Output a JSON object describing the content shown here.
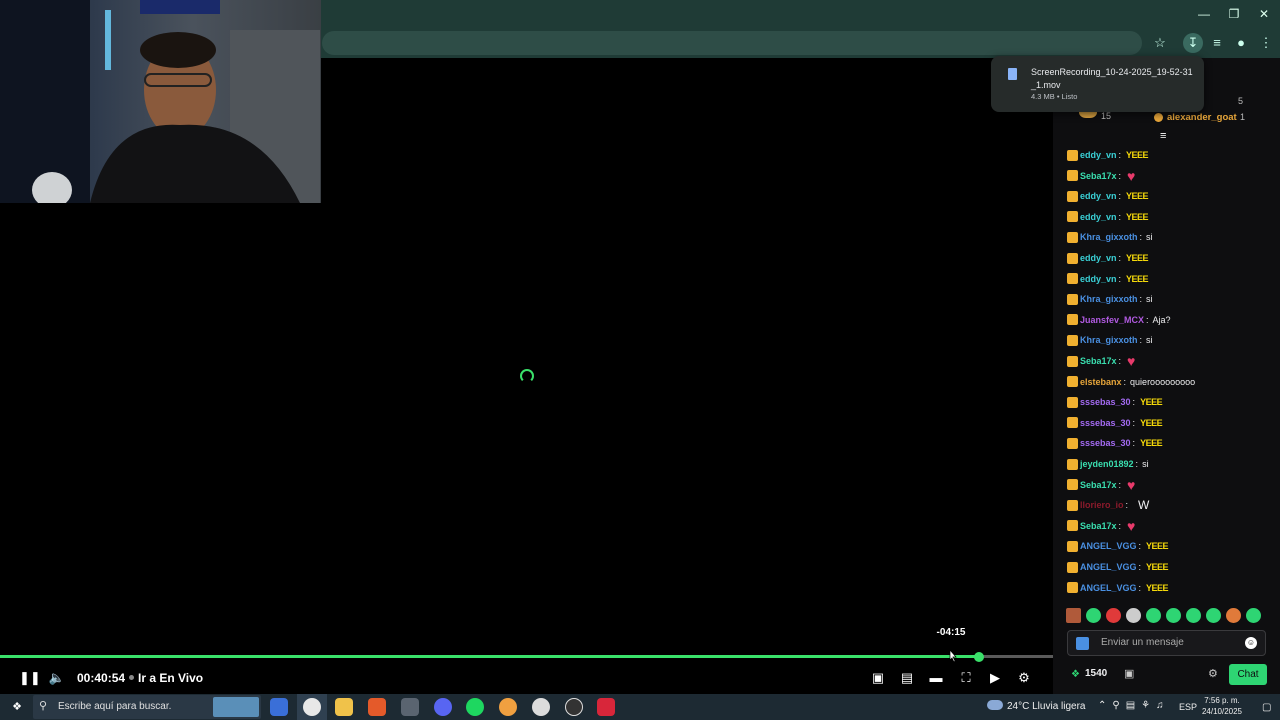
{
  "download": {
    "filename": "ScreenRecording_10-24-2025_19-52-31_1.mov",
    "status": "4.3 MB • Listo"
  },
  "player": {
    "seek_tooltip": "-04:15",
    "current_time": "00:40:54",
    "go_live_label": "Ir a En Vivo",
    "progress_fraction": 0.93
  },
  "chat_top": {
    "count_right": "5",
    "count_left": "15",
    "top_user": "alexander_goat",
    "top_user_count": "1"
  },
  "chat_messages": [
    {
      "user": "eddy_vn",
      "color": "#3ad0d6",
      "text": "",
      "emote": "YEEE"
    },
    {
      "user": "Seba17x",
      "color": "#3adfb0",
      "text": "",
      "emote": "heart"
    },
    {
      "user": "eddy_vn",
      "color": "#3ad0d6",
      "text": "",
      "emote": "YEEE"
    },
    {
      "user": "eddy_vn",
      "color": "#3ad0d6",
      "text": "",
      "emote": "YEEE"
    },
    {
      "user": "Khra_gixxoth",
      "color": "#4a90e2",
      "text": "si",
      "emote": ""
    },
    {
      "user": "eddy_vn",
      "color": "#3ad0d6",
      "text": "",
      "emote": "YEEE"
    },
    {
      "user": "eddy_vn",
      "color": "#3ad0d6",
      "text": "",
      "emote": "YEEE"
    },
    {
      "user": "Khra_gixxoth",
      "color": "#4a90e2",
      "text": "si",
      "emote": ""
    },
    {
      "user": "Juansfev_MCX",
      "color": "#b05ae0",
      "text": "Aja?",
      "emote": ""
    },
    {
      "user": "Khra_gixxoth",
      "color": "#4a90e2",
      "text": "si",
      "emote": ""
    },
    {
      "user": "Seba17x",
      "color": "#3adfb0",
      "text": "",
      "emote": "heart"
    },
    {
      "user": "elstebanx",
      "color": "#e6a53a",
      "text": "quierooooooooo",
      "emote": ""
    },
    {
      "user": "sssebas_30",
      "color": "#a46bf2",
      "text": "",
      "emote": "YEEE"
    },
    {
      "user": "sssebas_30",
      "color": "#a46bf2",
      "text": "",
      "emote": "YEEE"
    },
    {
      "user": "sssebas_30",
      "color": "#a46bf2",
      "text": "",
      "emote": "YEEE"
    },
    {
      "user": "jeyden01892",
      "color": "#3adfb0",
      "text": "si",
      "emote": ""
    },
    {
      "user": "Seba17x",
      "color": "#3adfb0",
      "text": "",
      "emote": "heart"
    },
    {
      "user": "lloriero_io",
      "color": "#8b1a2b",
      "text": "W",
      "emote": ""
    },
    {
      "user": "Seba17x",
      "color": "#3adfb0",
      "text": "",
      "emote": "heart"
    },
    {
      "user": "ANGEL_VGG",
      "color": "#4a90e2",
      "text": "",
      "emote": "YEEE"
    },
    {
      "user": "ANGEL_VGG",
      "color": "#4a90e2",
      "text": "",
      "emote": "YEEE"
    },
    {
      "user": "ANGEL_VGG",
      "color": "#4a90e2",
      "text": "",
      "emote": "YEEE"
    }
  ],
  "chat": {
    "input_placeholder": "Enviar un mensaje",
    "points": "1540",
    "chat_button": "Chat"
  },
  "taskbar": {
    "search_placeholder": "Escribe aquí para buscar.",
    "weather": "24°C  Lluvia ligera",
    "language": "ESP",
    "time": "7:56 p. m.",
    "date": "24/10/2025"
  },
  "colors": {
    "accent": "#3ae06a",
    "chrome": "#1f3b36",
    "chat_bg": "#0e0e10"
  }
}
